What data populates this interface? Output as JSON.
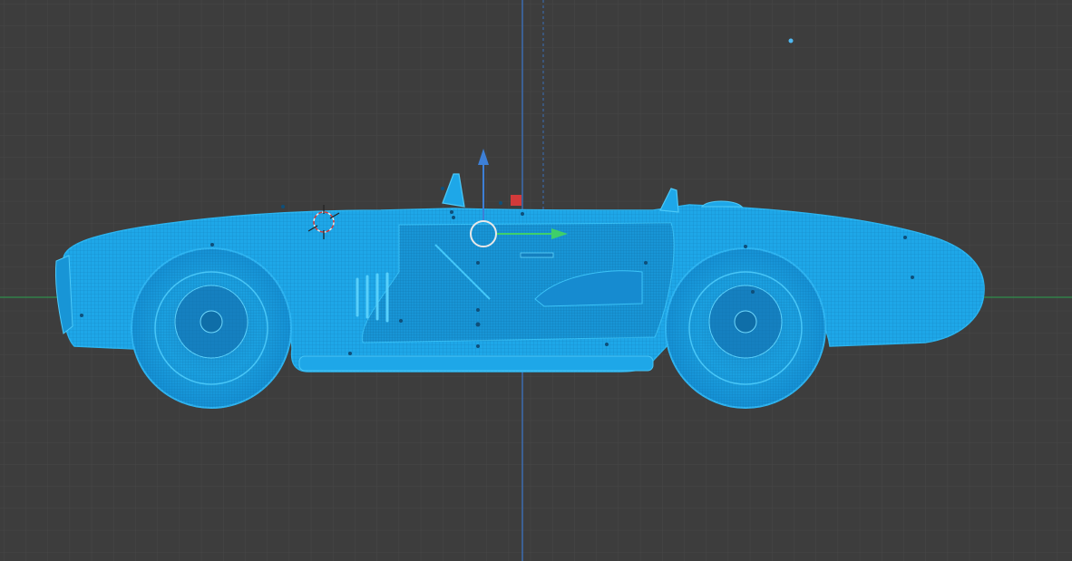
{
  "viewport": {
    "mode": "wireframe-side-view",
    "background_color": "#3d3d3d",
    "grid_minor_color": "#454545",
    "grid_major_color": "#4d4d4d",
    "axis_x_color": "#2f8f4b",
    "axis_z_color": "#3c6fb8"
  },
  "object": {
    "name": "",
    "wire_color": "#1ea7e8",
    "wire_dark": "#1683c4"
  },
  "gizmo": {
    "x_arrow_color": "#3fcf6a",
    "z_arrow_color": "#3d7fd6",
    "xz_plane_handle_color": "#d23a3a",
    "center_ring_color": "#e8e8e8"
  },
  "cursor_3d": {
    "icon": "3d-cursor-icon"
  }
}
